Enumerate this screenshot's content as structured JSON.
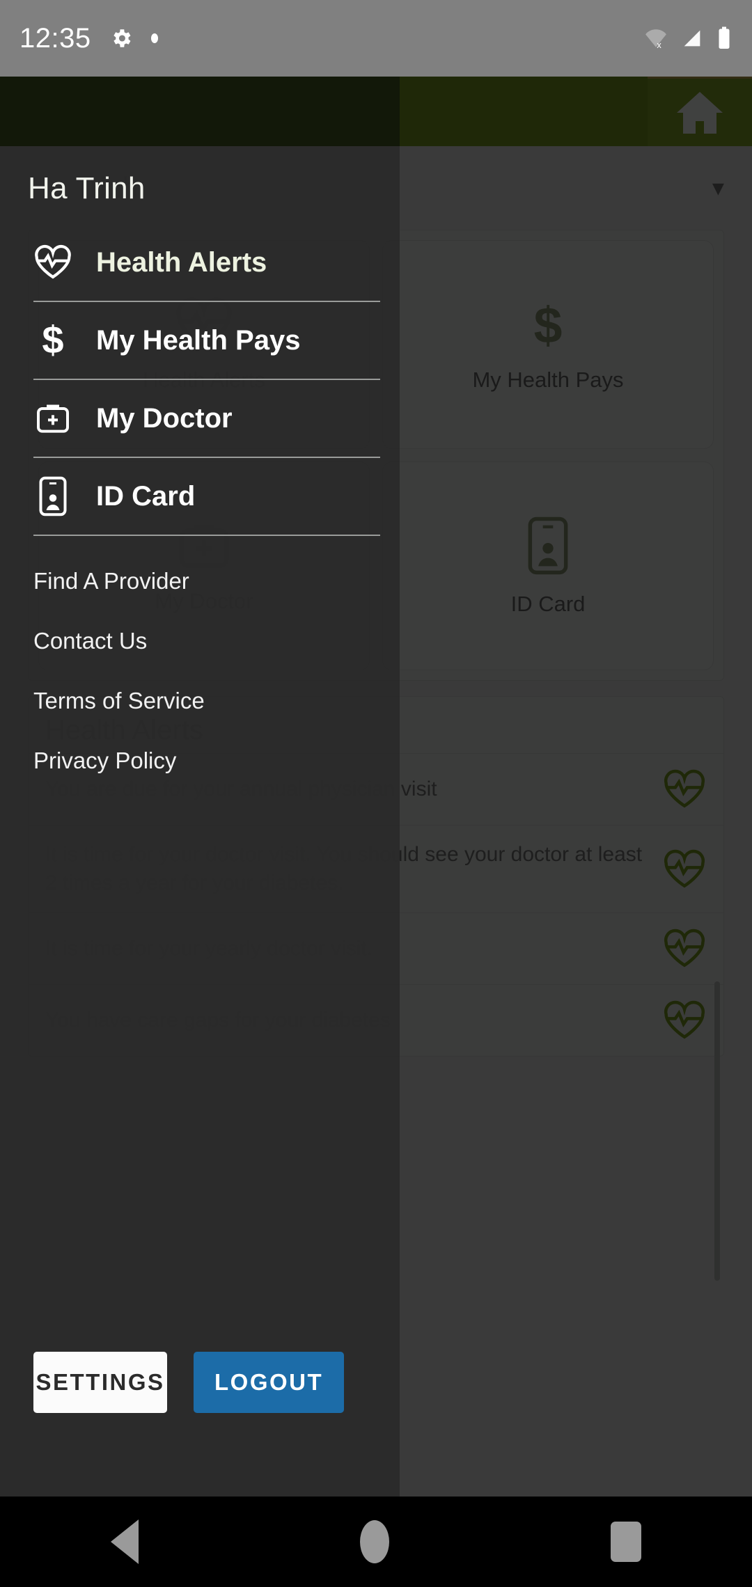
{
  "status_bar": {
    "time": "12:35",
    "icons": [
      "gear-icon",
      "dot-indicator",
      "wifi-off-icon",
      "signal-icon",
      "battery-icon"
    ]
  },
  "app_bar": {
    "menu_icon": "hamburger-menu-icon",
    "logo_icon": "shield-logo-icon",
    "home_icon": "home-icon",
    "home_button_color": "#7a9a24",
    "bar_color": "#6f8f1e"
  },
  "background": {
    "profile_name": "Ha Trinh",
    "expand_icon": "chevron-down-icon",
    "tiles": [
      {
        "label": "Health Alerts",
        "icon": "heart-pulse-icon"
      },
      {
        "label": "My Health Pays",
        "icon": "dollar-icon"
      },
      {
        "label": "My Doctor",
        "icon": "medical-bag-icon"
      },
      {
        "label": "ID Card",
        "icon": "id-card-icon"
      }
    ],
    "alerts_title": "Health Alerts",
    "alerts": [
      "You are due for your annual physician visit",
      "It is time for your doctor visit.  You should see your doctor at least 2 times a year for your diabetes.",
      "It is time for your yearly doctor visit.",
      "You have care gaps for your diabetes"
    ],
    "alert_icon": "heart-pulse-icon",
    "alert_icon_color": "#6f8f1e"
  },
  "drawer": {
    "user_name": "Ha Trinh",
    "nav_items": [
      {
        "label": "Health Alerts",
        "icon": "heart-pulse-icon",
        "active": true
      },
      {
        "label": "My Health Pays",
        "icon": "dollar-icon",
        "active": false
      },
      {
        "label": "My Doctor",
        "icon": "medical-bag-icon",
        "active": false
      },
      {
        "label": "ID Card",
        "icon": "id-card-icon",
        "active": false
      }
    ],
    "links": [
      "Find A Provider",
      "Contact Us",
      "Terms of Service",
      "Privacy Policy"
    ],
    "settings_button": "SETTINGS",
    "logout_button": "LOGOUT",
    "logout_color": "#1c6ca8"
  },
  "navigation_bar": {
    "back": "back-button",
    "home": "home-button",
    "recents": "recents-button"
  }
}
